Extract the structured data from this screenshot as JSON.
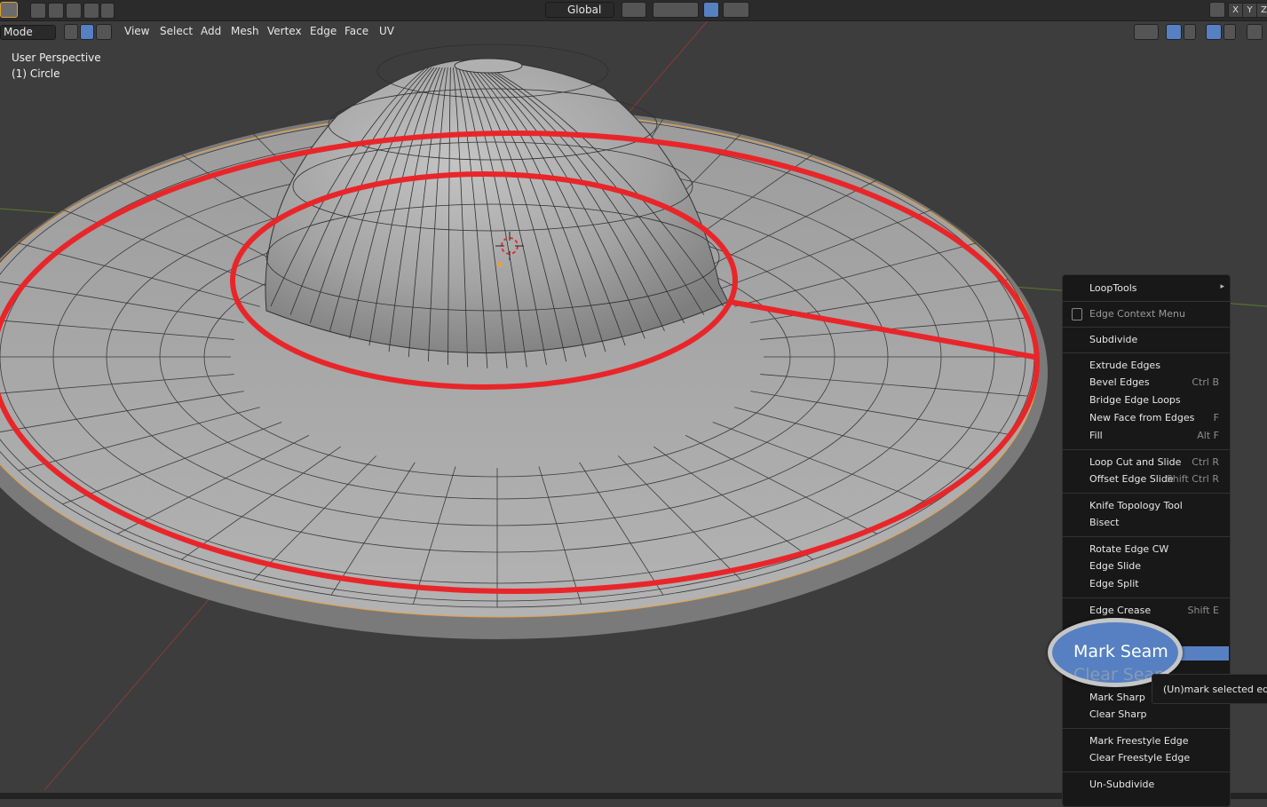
{
  "header": {
    "mode_label": "Mode",
    "menu": [
      "View",
      "Select",
      "Add",
      "Mesh",
      "Vertex",
      "Edge",
      "Face",
      "UV"
    ],
    "transform_orientation": "Global",
    "axis_x": "X",
    "axis_y": "Y",
    "axis_z": "Z"
  },
  "viewport": {
    "perspective": "User Perspective",
    "object": "(1) Circle"
  },
  "context_menu": {
    "loop_tools": "LoopTools",
    "title": "Edge Context Menu",
    "items": [
      {
        "label": "Subdivide",
        "shortcut": ""
      },
      {
        "label": "Extrude Edges",
        "shortcut": ""
      },
      {
        "label": "Bevel Edges",
        "shortcut": "Ctrl B"
      },
      {
        "label": "Bridge Edge Loops",
        "shortcut": ""
      },
      {
        "label": "New Face from Edges",
        "shortcut": "F"
      },
      {
        "label": "Fill",
        "shortcut": "Alt F"
      },
      {
        "label": "Loop Cut and Slide",
        "shortcut": "Ctrl R"
      },
      {
        "label": "Offset Edge Slide",
        "shortcut": "Shift Ctrl R"
      },
      {
        "label": "Knife Topology Tool",
        "shortcut": ""
      },
      {
        "label": "Bisect",
        "shortcut": ""
      },
      {
        "label": "Rotate Edge CW",
        "shortcut": ""
      },
      {
        "label": "Edge Slide",
        "shortcut": ""
      },
      {
        "label": "Edge Split",
        "shortcut": ""
      },
      {
        "label": "Edge Crease",
        "shortcut": "Shift E"
      },
      {
        "label": "Mark Sharp",
        "shortcut": ""
      },
      {
        "label": "Clear Sharp",
        "shortcut": ""
      },
      {
        "label": "Mark Freestyle Edge",
        "shortcut": ""
      },
      {
        "label": "Clear Freestyle Edge",
        "shortcut": ""
      },
      {
        "label": "Un-Subdivide",
        "shortcut": ""
      }
    ],
    "highlighted": "Mark Seam",
    "next_item": "Clear Seam",
    "tooltip": "(Un)mark selected edge"
  },
  "colors": {
    "annotation_red": "#e8262a",
    "highlight_blue": "#5680c2",
    "mesh_grey": "#a9a9a9"
  }
}
